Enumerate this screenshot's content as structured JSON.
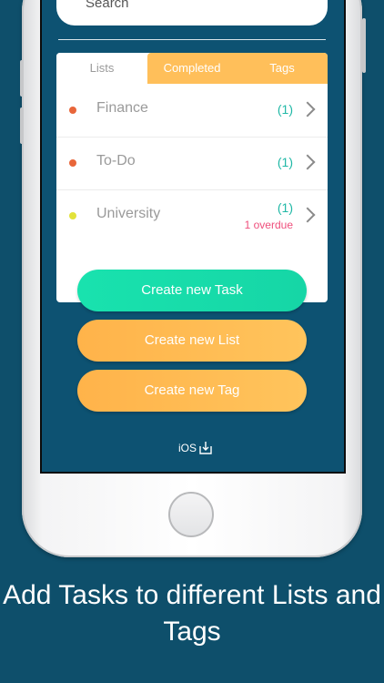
{
  "search": {
    "placeholder": "Search"
  },
  "tabs": [
    {
      "label": "Lists",
      "active": true
    },
    {
      "label": "Completed",
      "active": false
    },
    {
      "label": "Tags",
      "active": false
    }
  ],
  "lists": [
    {
      "name": "Finance",
      "count": "(1)",
      "overdue": "",
      "color": "#e8663a"
    },
    {
      "name": "To-Do",
      "count": "(1)",
      "overdue": "",
      "color": "#e8663a"
    },
    {
      "name": "University",
      "count": "(1)",
      "overdue": "1 overdue",
      "color": "#e2e23a"
    }
  ],
  "buttons": {
    "create_task": "Create new Task",
    "create_list": "Create new List",
    "create_tag": "Create new Tag"
  },
  "footer": {
    "platform": "iOS"
  },
  "caption": "Add Tasks to different Lists and Tags",
  "colors": {
    "background": "#0e4f6b",
    "screen": "#0d5272",
    "accent_green": "#19e2ae",
    "accent_orange": "#ffbf5a",
    "count_teal": "#20b8a6",
    "overdue_pink": "#ef4f7c"
  }
}
